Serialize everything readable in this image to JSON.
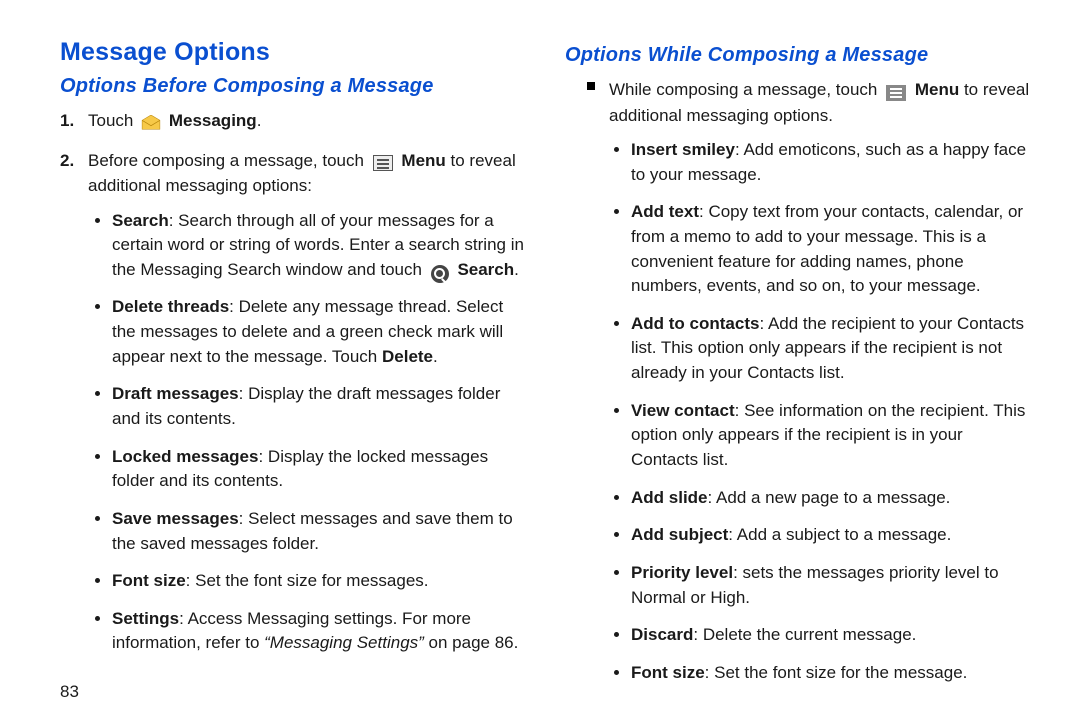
{
  "left": {
    "title": "Message Options",
    "subtitle": "Options Before Composing a Message",
    "step1_pre": "Touch ",
    "step1_bold": "Messaging",
    "step1_post": ".",
    "step2_pre": "Before composing a message, touch ",
    "step2_bold": "Menu",
    "step2_post": " to reveal additional messaging options:",
    "bullets": [
      {
        "t": "Search",
        "d": ": Search through all of your messages for a certain word or string of words. Enter a search string in the Messaging Search window and touch ",
        "post_bold": "Search",
        "post": "."
      },
      {
        "t": "Delete threads",
        "d": ": Delete any message thread. Select the messages to delete and a green check mark will appear next to the message. Touch ",
        "post_bold": "Delete",
        "post": "."
      },
      {
        "t": "Draft messages",
        "d": ": Display the draft messages folder and its contents."
      },
      {
        "t": "Locked messages",
        "d": ": Display the locked messages folder and its contents."
      },
      {
        "t": "Save messages",
        "d": ": Select messages and save them to the saved messages folder."
      },
      {
        "t": "Font size",
        "d": ": Set the font size for messages."
      },
      {
        "t": "Settings",
        "d": ": Access Messaging settings. For more information, refer to ",
        "xref": "“Messaging Settings”",
        "post": " on page 86."
      }
    ],
    "pagenum": "83"
  },
  "right": {
    "subtitle": "Options While Composing a Message",
    "lead_pre": "While composing a message, touch ",
    "lead_bold": "Menu",
    "lead_post": " to reveal additional messaging options.",
    "bullets": [
      {
        "t": "Insert smiley",
        "d": ": Add emoticons, such as a happy face to your message."
      },
      {
        "t": "Add text",
        "d": ": Copy text from your contacts, calendar, or from a memo to add to your message. This is a convenient feature for adding names, phone numbers, events, and so on, to your message."
      },
      {
        "t": "Add to contacts",
        "d": ": Add the recipient to your Contacts list. This option only appears if the recipient is not already in your Contacts list."
      },
      {
        "t": "View contact",
        "d": ": See information on the recipient. This option only appears if the recipient is in your Contacts list."
      },
      {
        "t": "Add slide",
        "d": ": Add a new page to a message."
      },
      {
        "t": "Add subject",
        "d": ": Add a subject to a message."
      },
      {
        "t": "Priority level",
        "d": ": sets the messages priority level to Normal or High."
      },
      {
        "t": "Discard",
        "d": ": Delete the current message."
      },
      {
        "t": "Font size",
        "d": ": Set the font size for the message."
      }
    ]
  }
}
